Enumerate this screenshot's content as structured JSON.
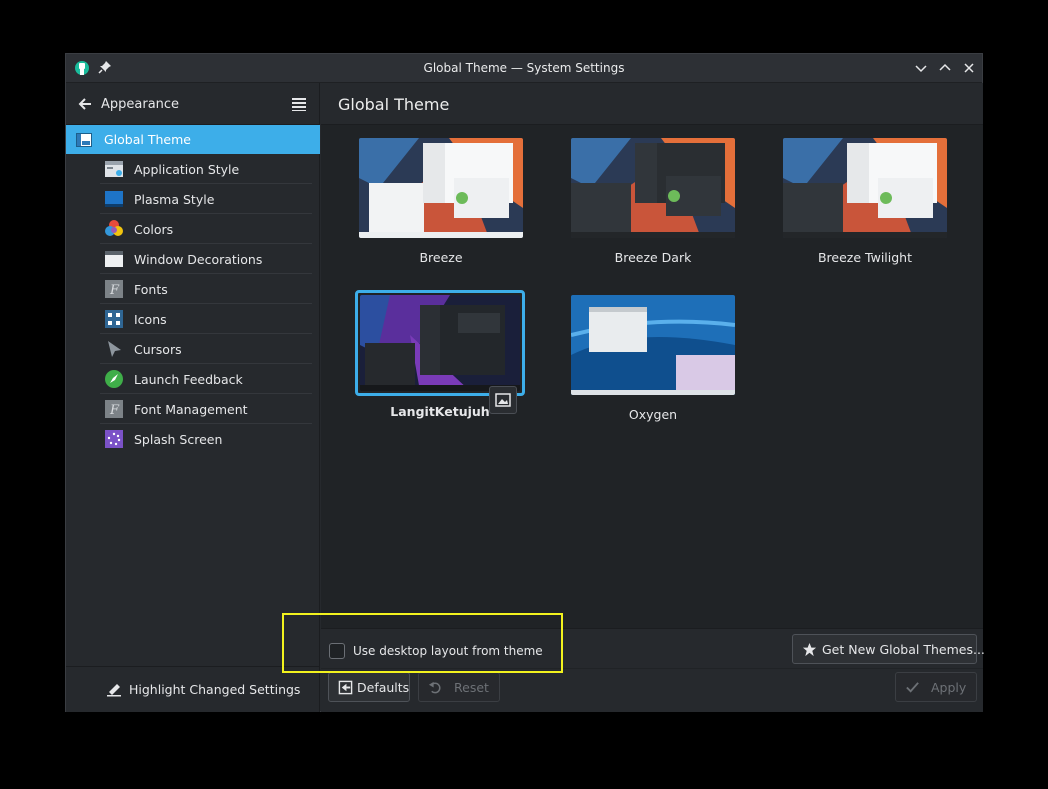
{
  "window": {
    "title": "Global Theme — System Settings"
  },
  "sidebar": {
    "back_label": "Appearance",
    "selected": {
      "label": "Global Theme",
      "icon": "global-theme-icon"
    },
    "items": [
      {
        "label": "Application Style",
        "icon": "application-style-icon"
      },
      {
        "label": "Plasma Style",
        "icon": "plasma-style-icon"
      },
      {
        "label": "Colors",
        "icon": "colors-icon"
      },
      {
        "label": "Window Decorations",
        "icon": "window-decorations-icon"
      },
      {
        "label": "Fonts",
        "icon": "fonts-icon"
      },
      {
        "label": "Icons",
        "icon": "icons-icon"
      },
      {
        "label": "Cursors",
        "icon": "cursors-icon"
      },
      {
        "label": "Launch Feedback",
        "icon": "launch-feedback-icon"
      },
      {
        "label": "Font Management",
        "icon": "font-management-icon"
      },
      {
        "label": "Splash Screen",
        "icon": "splash-screen-icon"
      }
    ],
    "footer_label": "Highlight Changed Settings"
  },
  "main": {
    "title": "Global Theme",
    "themes": [
      {
        "name": "Breeze"
      },
      {
        "name": "Breeze Dark"
      },
      {
        "name": "Breeze Twilight"
      },
      {
        "name": "LangitKetujuh",
        "selected": true
      },
      {
        "name": "Oxygen"
      }
    ],
    "checkbox_label": "Use desktop layout from theme",
    "checkbox_checked": false,
    "get_new_label": "Get New Global Themes...",
    "defaults_label": "Defaults",
    "reset_label": "Reset",
    "apply_label": "Apply"
  },
  "colors": {
    "accent": "#3daee9",
    "highlight_annotation": "#f2f21e"
  }
}
